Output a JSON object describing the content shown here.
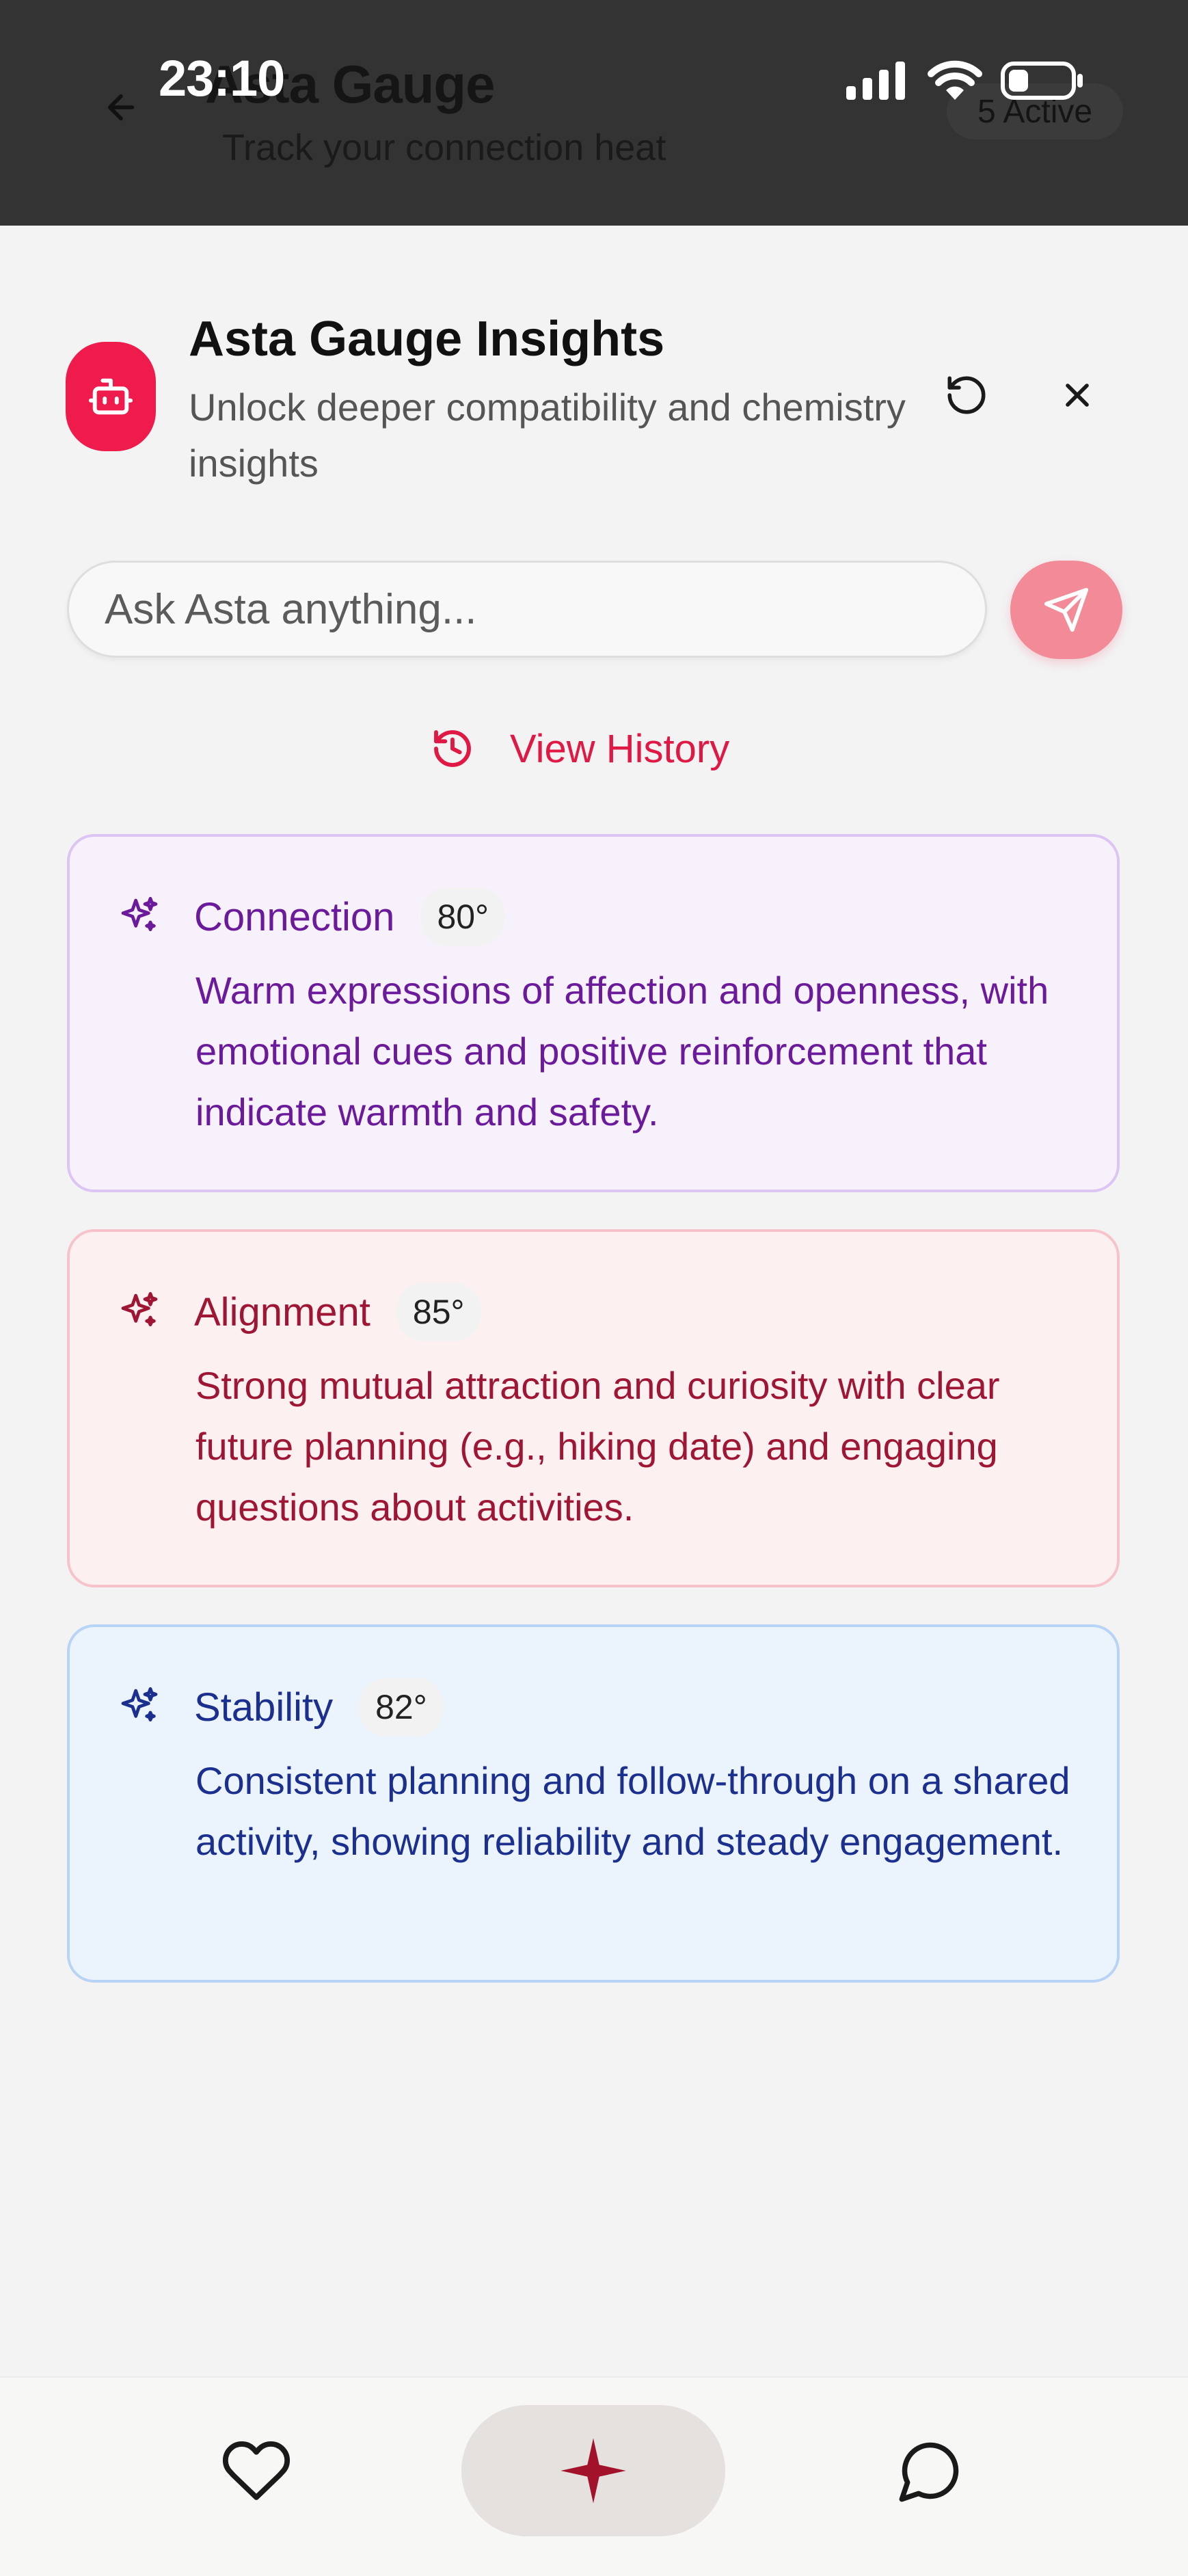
{
  "status_bar": {
    "time": "23:10"
  },
  "background_header": {
    "title": "Asta Gauge",
    "subtitle": "Track your connection heat",
    "badge": "5 Active"
  },
  "sheet": {
    "title": "Asta Gauge Insights",
    "subtitle": "Unlock deeper compatibility and chemistry insights",
    "ask_placeholder": "Ask Asta anything...",
    "history_label": "View History"
  },
  "insights": [
    {
      "label": "Connection",
      "degree": "80°",
      "text": "Warm expressions of affection and openness, with emotional cues and positive reinforcement that indicate warmth and safety.",
      "accent": "#6a1a9a"
    },
    {
      "label": "Alignment",
      "degree": "85°",
      "text": "Strong mutual attraction and curiosity with clear future planning (e.g., hiking date) and engaging questions about activities.",
      "accent": "#9f1634"
    },
    {
      "label": "Stability",
      "degree": "82°",
      "text": "Consistent planning and follow-through on a shared activity, showing reliability and steady engagement.",
      "accent": "#1b2f8f"
    }
  ],
  "bottom_nav": {
    "items": [
      "heart-icon",
      "sparkle-icon",
      "chat-bubble-icon"
    ],
    "active": "sparkle-icon"
  },
  "colors": {
    "brand": "#ef1b4c",
    "send_button": "#f28a97",
    "link": "#df1844"
  }
}
